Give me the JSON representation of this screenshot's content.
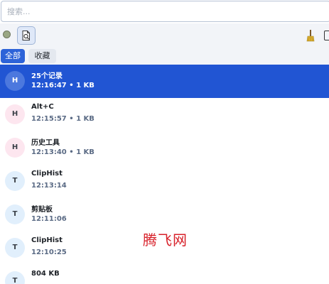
{
  "search": {
    "placeholder": "搜索..."
  },
  "toolbar": {
    "status_icon": "status-dot-icon",
    "toggle_icon": "document-search-icon",
    "clean_icon": "broom-icon",
    "edge_icon": "window-icon"
  },
  "tabs": [
    {
      "label": "全部",
      "active": true
    },
    {
      "label": "收藏",
      "active": false
    }
  ],
  "items": [
    {
      "avatar": "H",
      "title": "25个记录",
      "meta": "12:16:47 • 1 KB",
      "selected": true
    },
    {
      "avatar": "H",
      "title": "Alt+C",
      "meta": "12:15:57 • 1 KB",
      "selected": false
    },
    {
      "avatar": "H",
      "title": "历史工具",
      "meta": "12:13:40 • 1 KB",
      "selected": false
    },
    {
      "avatar": "T",
      "title": "ClipHist",
      "meta": "12:13:14",
      "selected": false
    },
    {
      "avatar": "T",
      "title": "剪贴板",
      "meta": "12:11:06",
      "selected": false
    },
    {
      "avatar": "T",
      "title": "ClipHist",
      "meta": "12:10:25",
      "selected": false
    },
    {
      "avatar": "T",
      "title": "804 KB",
      "meta": "",
      "selected": false
    }
  ],
  "watermark": "腾飞网",
  "colors": {
    "accent": "#2155d3",
    "tab_active": "#2d63d8",
    "watermark": "#d71f28"
  }
}
